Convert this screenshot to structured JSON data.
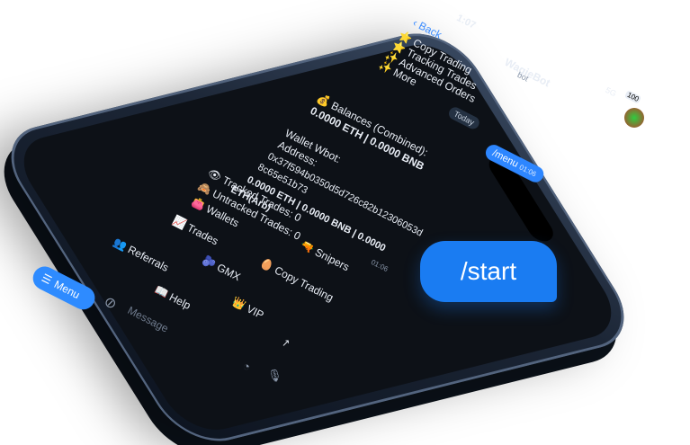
{
  "header": {
    "back_label": "Back",
    "time": "1:07",
    "bot_name": "WagieBot",
    "bot_sub": "bot",
    "network": "5G",
    "battery": "100"
  },
  "features": [
    "Copy Trading",
    "Tracking Trades",
    "Advanced Orders",
    "More"
  ],
  "today_label": "Today",
  "command": {
    "text": "/menu",
    "time": "01:06"
  },
  "message": {
    "lines": [
      "Balances (Combined):",
      "0.0000 ETH | 0.0000 BNB",
      "Wallet Wbot:",
      "Address:",
      "0x37f594b0350d5d726c82b12306053d",
      "8c65e51b73",
      "0.0000 ETH | 0.0000 BNB | 0.0000",
      "ETH(Arb)",
      "Tracked Trades: 0",
      "Untracked Trades: 0"
    ],
    "time": "01:06"
  },
  "keyboard": {
    "wallets": "Wallets",
    "trades": "Trades",
    "snipers": "Snipers",
    "referrals": "Referrals",
    "gmx": "GMX",
    "copy_trading": "Copy Trading",
    "help": "Help",
    "vip": "VIP"
  },
  "composer": {
    "menu_label": "Menu",
    "placeholder": "Message"
  },
  "start_bubble": "/start",
  "colors": {
    "accent": "#2e8bff",
    "screen": "#0d1117",
    "bubble": "#1f2a3a"
  }
}
